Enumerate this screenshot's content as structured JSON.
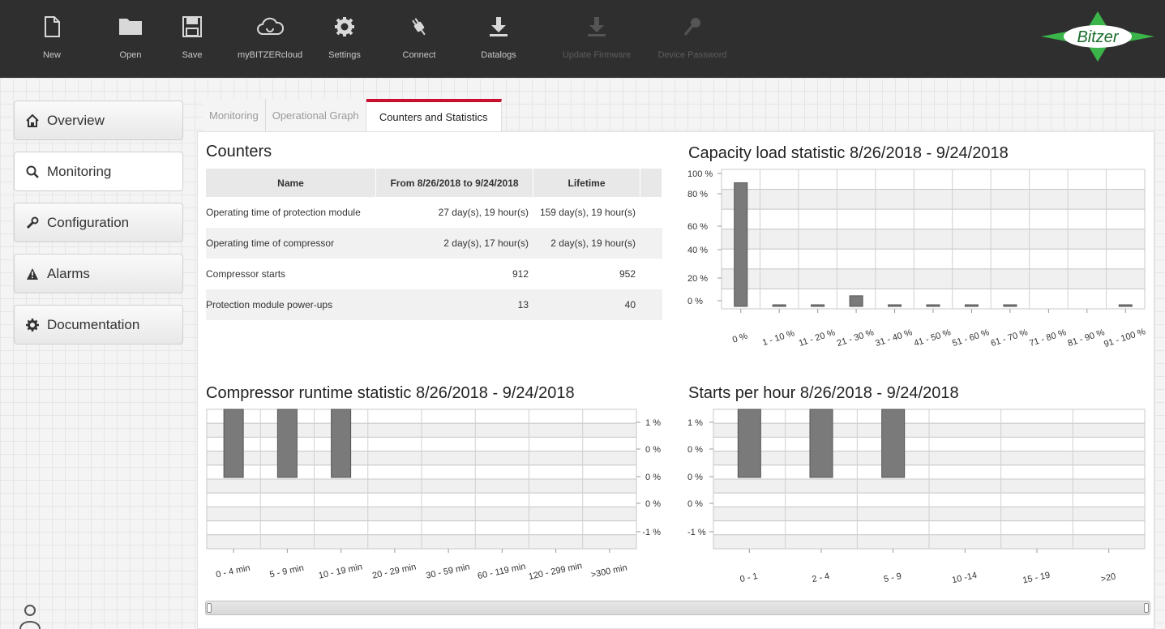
{
  "toolbar": {
    "buttons": [
      {
        "label": "New",
        "icon": "new-file-icon",
        "enabled": true
      },
      {
        "label": "Open",
        "icon": "folder-icon",
        "enabled": true
      },
      {
        "label": "Save",
        "icon": "save-icon",
        "enabled": true
      },
      {
        "label": "myBITZERcloud",
        "icon": "cloud-icon",
        "enabled": true
      },
      {
        "label": "Settings",
        "icon": "gear-icon",
        "enabled": true
      },
      {
        "label": "Connect",
        "icon": "plug-icon",
        "enabled": true
      },
      {
        "label": "Datalogs",
        "icon": "download-icon",
        "enabled": true
      },
      {
        "label": "Update Firmware",
        "icon": "download-icon",
        "enabled": false
      },
      {
        "label": "Device Password",
        "icon": "key-icon",
        "enabled": false
      }
    ],
    "logo_text": "Bitzer",
    "logo_color": "#3bb54a"
  },
  "sidebar": {
    "items": [
      {
        "label": "Overview",
        "icon": "home-icon",
        "active": false
      },
      {
        "label": "Monitoring",
        "icon": "search-icon",
        "active": true
      },
      {
        "label": "Configuration",
        "icon": "wrench-icon",
        "active": false
      },
      {
        "label": "Alarms",
        "icon": "warning-icon",
        "active": false
      },
      {
        "label": "Documentation",
        "icon": "gear-icon",
        "active": false
      }
    ]
  },
  "tabs": [
    {
      "label": "Monitoring",
      "active": false
    },
    {
      "label": "Operational Graph",
      "active": false
    },
    {
      "label": "Counters and Statistics",
      "active": true
    }
  ],
  "accent_color": "#c8102e",
  "counters": {
    "title": "Counters",
    "columns": [
      "Name",
      "From 8/26/2018 to 9/24/2018",
      "Lifetime"
    ],
    "rows": [
      [
        "Operating time of protection module",
        "27 day(s), 19 hour(s)",
        "159 day(s), 19 hour(s)"
      ],
      [
        "Operating time of compressor",
        "2 day(s), 17 hour(s)",
        "2 day(s), 19 hour(s)"
      ],
      [
        "Compressor starts",
        "912",
        "952"
      ],
      [
        "Protection module power-ups",
        "13",
        "40"
      ]
    ]
  },
  "chart_data": [
    {
      "type": "bar",
      "title": "Capacity load statistic 8/26/2018 - 9/24/2018",
      "categories": [
        "0 %",
        "1 - 10 %",
        "11 - 20 %",
        "21 - 30 %",
        "31 - 40 %",
        "41 - 50 %",
        "51 - 60 %",
        "61 - 70 %",
        "71 - 80 %",
        "81 - 90 %",
        "91 - 100 %"
      ],
      "values": [
        93,
        1,
        1,
        8,
        1,
        1,
        1,
        1,
        0,
        0,
        1
      ],
      "yticks": [
        "100 %",
        "80 %",
        "60 %",
        "40 %",
        "20 %",
        "0 %"
      ],
      "ylim": [
        0,
        100
      ],
      "grid": true
    },
    {
      "type": "bar",
      "title": "Compressor runtime statistic 8/26/2018 - 9/24/2018",
      "categories": [
        "0 - 4 min",
        "5 - 9 min",
        "10 - 19 min",
        "20 - 29 min",
        "30 - 59 min",
        "60 - 119 min",
        "120 - 299 min",
        ">300 min"
      ],
      "values": [
        1,
        1,
        1,
        0,
        0,
        0,
        0,
        0
      ],
      "yticks": [
        "1 %",
        "0 %",
        "0 %",
        "0 %",
        "-1 %"
      ],
      "ylim": [
        -1,
        1
      ],
      "axis_side": "right",
      "grid": true
    },
    {
      "type": "bar",
      "title": "Starts per hour 8/26/2018 - 9/24/2018",
      "categories": [
        "0 - 1",
        "2 - 4",
        "5 - 9",
        "10 -14",
        "15 - 19",
        ">20"
      ],
      "values": [
        1,
        1,
        1,
        0,
        0,
        0
      ],
      "yticks": [
        "1 %",
        "0 %",
        "0 %",
        "0 %",
        "-1 %"
      ],
      "ylim": [
        -1,
        1
      ],
      "axis_side": "left",
      "grid": true
    }
  ]
}
